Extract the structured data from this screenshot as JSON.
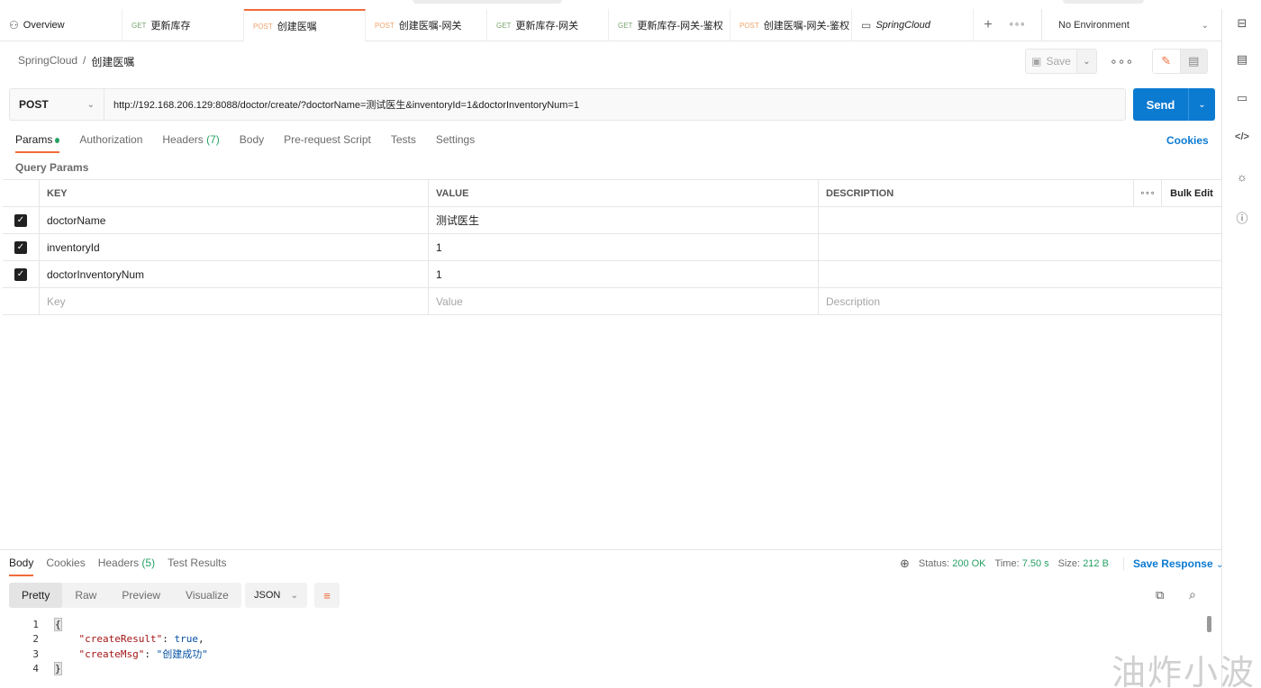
{
  "tabs": [
    {
      "method": "",
      "icon": "overview-icon",
      "label": "Overview"
    },
    {
      "method": "GET",
      "label": "更新库存"
    },
    {
      "method": "POST",
      "label": "创建医嘱",
      "active": true
    },
    {
      "method": "POST",
      "label": "创建医嘱-网关"
    },
    {
      "method": "GET",
      "label": "更新库存-网关"
    },
    {
      "method": "GET",
      "label": "更新库存-网关-鉴权"
    },
    {
      "method": "POST",
      "label": "创建医嘱-网关-鉴权"
    },
    {
      "method": "",
      "icon": "collection-icon",
      "label": "SpringCloud"
    }
  ],
  "tab_actions": {
    "add": "+",
    "more": "∘∘∘"
  },
  "environment": "No Environment",
  "breadcrumb": {
    "collection": "SpringCloud",
    "separator": "/",
    "current": "创建医嘱"
  },
  "toolbar": {
    "save_label": "Save"
  },
  "request": {
    "method": "POST",
    "url": "http://192.168.206.129:8088/doctor/create/?doctorName=测试医生&inventoryId=1&doctorInventoryNum=1",
    "send_label": "Send"
  },
  "request_tabs": {
    "params": "Params",
    "authorization": "Authorization",
    "headers": "Headers",
    "headers_count": "(7)",
    "body": "Body",
    "prerequest": "Pre-request Script",
    "tests": "Tests",
    "settings": "Settings",
    "cookies": "Cookies"
  },
  "query_params": {
    "title": "Query Params",
    "headers": {
      "key": "KEY",
      "value": "VALUE",
      "description": "DESCRIPTION",
      "more": "∘∘∘",
      "bulk_edit": "Bulk Edit"
    },
    "rows": [
      {
        "checked": true,
        "key": "doctorName",
        "value": "测试医生",
        "description": ""
      },
      {
        "checked": true,
        "key": "inventoryId",
        "value": "1",
        "description": ""
      },
      {
        "checked": true,
        "key": "doctorInventoryNum",
        "value": "1",
        "description": ""
      }
    ],
    "placeholder": {
      "key": "Key",
      "value": "Value",
      "description": "Description"
    }
  },
  "response": {
    "tabs": {
      "body": "Body",
      "cookies": "Cookies",
      "headers": "Headers",
      "headers_count": "(5)",
      "test_results": "Test Results"
    },
    "status_label": "Status:",
    "status": "200 OK",
    "time_label": "Time:",
    "time": "7.50 s",
    "size_label": "Size:",
    "size": "212 B",
    "save_response": "Save Response",
    "formats": {
      "pretty": "Pretty",
      "raw": "Raw",
      "preview": "Preview",
      "visualize": "Visualize"
    },
    "language": "JSON",
    "lines": {
      "n1": "1",
      "n2": "2",
      "n3": "3",
      "n4": "4",
      "open": "{",
      "key1": "\"createResult\"",
      "val1": "true",
      "key2": "\"createMsg\"",
      "val2": "\"创建成功\"",
      "close": "}"
    }
  },
  "watermark": "油炸小波",
  "colors": {
    "accent": "#f26b3a",
    "primary": "#0b7ad1",
    "success": "#27a163"
  }
}
